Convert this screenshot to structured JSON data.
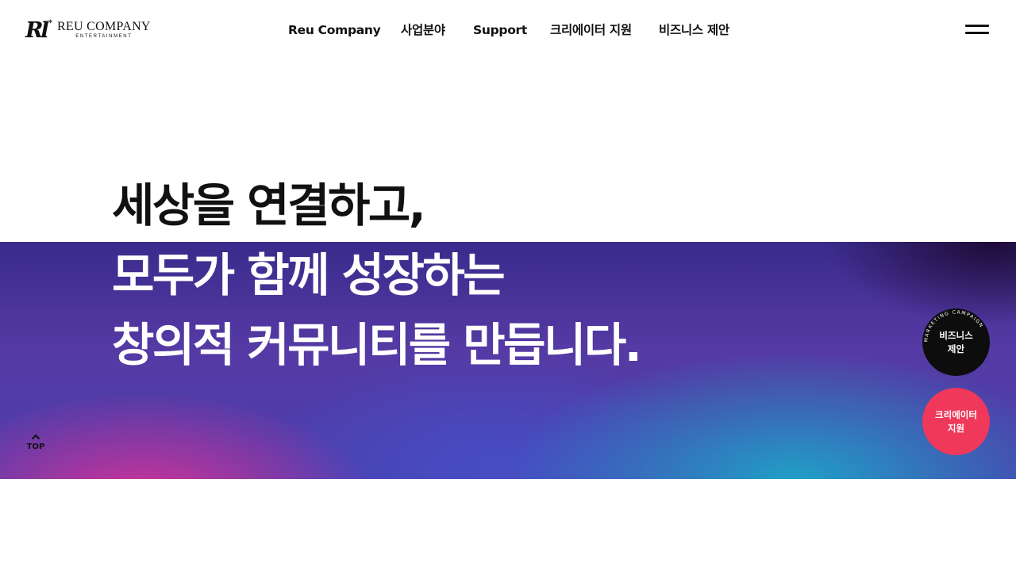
{
  "brand": {
    "mark": "Rl",
    "name": "REU COMPANY",
    "subtitle": "ENTERTAINMENT"
  },
  "nav": {
    "items": [
      {
        "id": "reu-company",
        "label": "Reu Company"
      },
      {
        "id": "business",
        "label": "사업분야"
      },
      {
        "id": "support",
        "label": "Support"
      },
      {
        "id": "creator-support",
        "label": "크리에이터 지원"
      },
      {
        "id": "business-proposal",
        "label": "비즈니스 제안"
      }
    ],
    "menu_icon": "hamburger-menu-icon"
  },
  "hero": {
    "lines": [
      "세상을 연결하고,",
      "모두가 함께 성장하는",
      "창의적 커뮤니티를 만듭니다."
    ]
  },
  "top_button": {
    "label": "TOP",
    "icon": "chevron-up-icon"
  },
  "floating": {
    "business": {
      "label_line1": "비즈니스",
      "label_line2": "제안",
      "ring_text": "MARKETING CAMPAIGN"
    },
    "creator": {
      "label_line1": "크리에이터",
      "label_line2": "지원"
    }
  },
  "colors": {
    "text": "#111111",
    "creator_button": "#f0385a",
    "business_button": "#0d0d0d",
    "gradient_pink": "#e23096",
    "gradient_cyan": "#1ea5c8",
    "gradient_purple": "#3a2b8c"
  }
}
